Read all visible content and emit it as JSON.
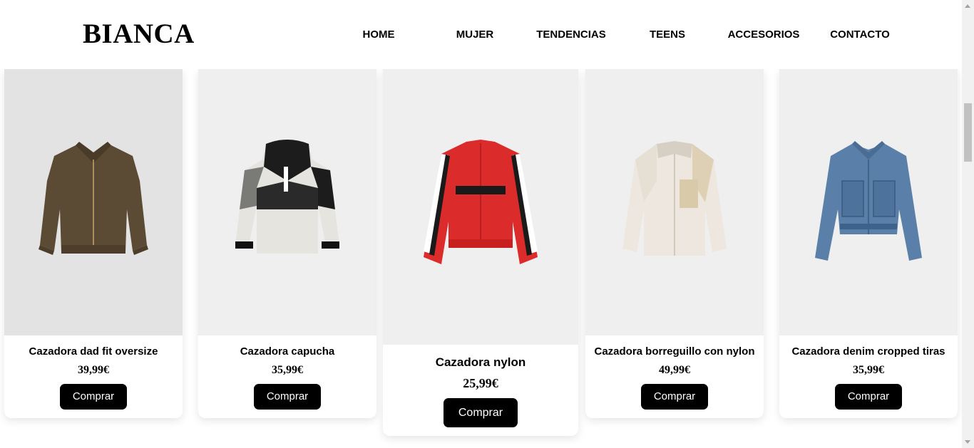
{
  "header": {
    "logo": "BIANCA",
    "nav": [
      "HOME",
      "MUJER",
      "TENDENCIAS",
      "TEENS",
      "ACCESORIOS",
      "CONTACTO"
    ]
  },
  "products": [
    {
      "name": "Cazadora dad fit oversize",
      "price": "39,99€",
      "button": "Comprar",
      "image": "brown-leather-jacket"
    },
    {
      "name": "Cazadora capucha",
      "price": "35,99€",
      "button": "Comprar",
      "image": "windbreaker-hood-jacket"
    },
    {
      "name": "Cazadora nylon",
      "price": "25,99€",
      "button": "Comprar",
      "image": "red-track-jacket"
    },
    {
      "name": "Cazadora borreguillo con nylon",
      "price": "49,99€",
      "button": "Comprar",
      "image": "sherpa-fleece-jacket"
    },
    {
      "name": "Cazadora denim cropped tiras",
      "price": "35,99€",
      "button": "Comprar",
      "image": "denim-cropped-jacket"
    }
  ],
  "colors": {
    "button_bg": "#000000",
    "button_text": "#ffffff",
    "image_bg": "#efefef"
  }
}
